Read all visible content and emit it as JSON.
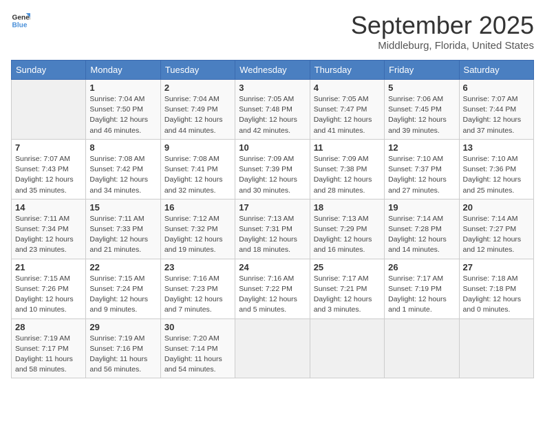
{
  "logo": {
    "general": "General",
    "blue": "Blue"
  },
  "title": "September 2025",
  "location": "Middleburg, Florida, United States",
  "days_of_week": [
    "Sunday",
    "Monday",
    "Tuesday",
    "Wednesday",
    "Thursday",
    "Friday",
    "Saturday"
  ],
  "weeks": [
    [
      {
        "day": "",
        "info": ""
      },
      {
        "day": "1",
        "info": "Sunrise: 7:04 AM\nSunset: 7:50 PM\nDaylight: 12 hours\nand 46 minutes."
      },
      {
        "day": "2",
        "info": "Sunrise: 7:04 AM\nSunset: 7:49 PM\nDaylight: 12 hours\nand 44 minutes."
      },
      {
        "day": "3",
        "info": "Sunrise: 7:05 AM\nSunset: 7:48 PM\nDaylight: 12 hours\nand 42 minutes."
      },
      {
        "day": "4",
        "info": "Sunrise: 7:05 AM\nSunset: 7:47 PM\nDaylight: 12 hours\nand 41 minutes."
      },
      {
        "day": "5",
        "info": "Sunrise: 7:06 AM\nSunset: 7:45 PM\nDaylight: 12 hours\nand 39 minutes."
      },
      {
        "day": "6",
        "info": "Sunrise: 7:07 AM\nSunset: 7:44 PM\nDaylight: 12 hours\nand 37 minutes."
      }
    ],
    [
      {
        "day": "7",
        "info": "Sunrise: 7:07 AM\nSunset: 7:43 PM\nDaylight: 12 hours\nand 35 minutes."
      },
      {
        "day": "8",
        "info": "Sunrise: 7:08 AM\nSunset: 7:42 PM\nDaylight: 12 hours\nand 34 minutes."
      },
      {
        "day": "9",
        "info": "Sunrise: 7:08 AM\nSunset: 7:41 PM\nDaylight: 12 hours\nand 32 minutes."
      },
      {
        "day": "10",
        "info": "Sunrise: 7:09 AM\nSunset: 7:39 PM\nDaylight: 12 hours\nand 30 minutes."
      },
      {
        "day": "11",
        "info": "Sunrise: 7:09 AM\nSunset: 7:38 PM\nDaylight: 12 hours\nand 28 minutes."
      },
      {
        "day": "12",
        "info": "Sunrise: 7:10 AM\nSunset: 7:37 PM\nDaylight: 12 hours\nand 27 minutes."
      },
      {
        "day": "13",
        "info": "Sunrise: 7:10 AM\nSunset: 7:36 PM\nDaylight: 12 hours\nand 25 minutes."
      }
    ],
    [
      {
        "day": "14",
        "info": "Sunrise: 7:11 AM\nSunset: 7:34 PM\nDaylight: 12 hours\nand 23 minutes."
      },
      {
        "day": "15",
        "info": "Sunrise: 7:11 AM\nSunset: 7:33 PM\nDaylight: 12 hours\nand 21 minutes."
      },
      {
        "day": "16",
        "info": "Sunrise: 7:12 AM\nSunset: 7:32 PM\nDaylight: 12 hours\nand 19 minutes."
      },
      {
        "day": "17",
        "info": "Sunrise: 7:13 AM\nSunset: 7:31 PM\nDaylight: 12 hours\nand 18 minutes."
      },
      {
        "day": "18",
        "info": "Sunrise: 7:13 AM\nSunset: 7:29 PM\nDaylight: 12 hours\nand 16 minutes."
      },
      {
        "day": "19",
        "info": "Sunrise: 7:14 AM\nSunset: 7:28 PM\nDaylight: 12 hours\nand 14 minutes."
      },
      {
        "day": "20",
        "info": "Sunrise: 7:14 AM\nSunset: 7:27 PM\nDaylight: 12 hours\nand 12 minutes."
      }
    ],
    [
      {
        "day": "21",
        "info": "Sunrise: 7:15 AM\nSunset: 7:26 PM\nDaylight: 12 hours\nand 10 minutes."
      },
      {
        "day": "22",
        "info": "Sunrise: 7:15 AM\nSunset: 7:24 PM\nDaylight: 12 hours\nand 9 minutes."
      },
      {
        "day": "23",
        "info": "Sunrise: 7:16 AM\nSunset: 7:23 PM\nDaylight: 12 hours\nand 7 minutes."
      },
      {
        "day": "24",
        "info": "Sunrise: 7:16 AM\nSunset: 7:22 PM\nDaylight: 12 hours\nand 5 minutes."
      },
      {
        "day": "25",
        "info": "Sunrise: 7:17 AM\nSunset: 7:21 PM\nDaylight: 12 hours\nand 3 minutes."
      },
      {
        "day": "26",
        "info": "Sunrise: 7:17 AM\nSunset: 7:19 PM\nDaylight: 12 hours\nand 1 minute."
      },
      {
        "day": "27",
        "info": "Sunrise: 7:18 AM\nSunset: 7:18 PM\nDaylight: 12 hours\nand 0 minutes."
      }
    ],
    [
      {
        "day": "28",
        "info": "Sunrise: 7:19 AM\nSunset: 7:17 PM\nDaylight: 11 hours\nand 58 minutes."
      },
      {
        "day": "29",
        "info": "Sunrise: 7:19 AM\nSunset: 7:16 PM\nDaylight: 11 hours\nand 56 minutes."
      },
      {
        "day": "30",
        "info": "Sunrise: 7:20 AM\nSunset: 7:14 PM\nDaylight: 11 hours\nand 54 minutes."
      },
      {
        "day": "",
        "info": ""
      },
      {
        "day": "",
        "info": ""
      },
      {
        "day": "",
        "info": ""
      },
      {
        "day": "",
        "info": ""
      }
    ]
  ]
}
